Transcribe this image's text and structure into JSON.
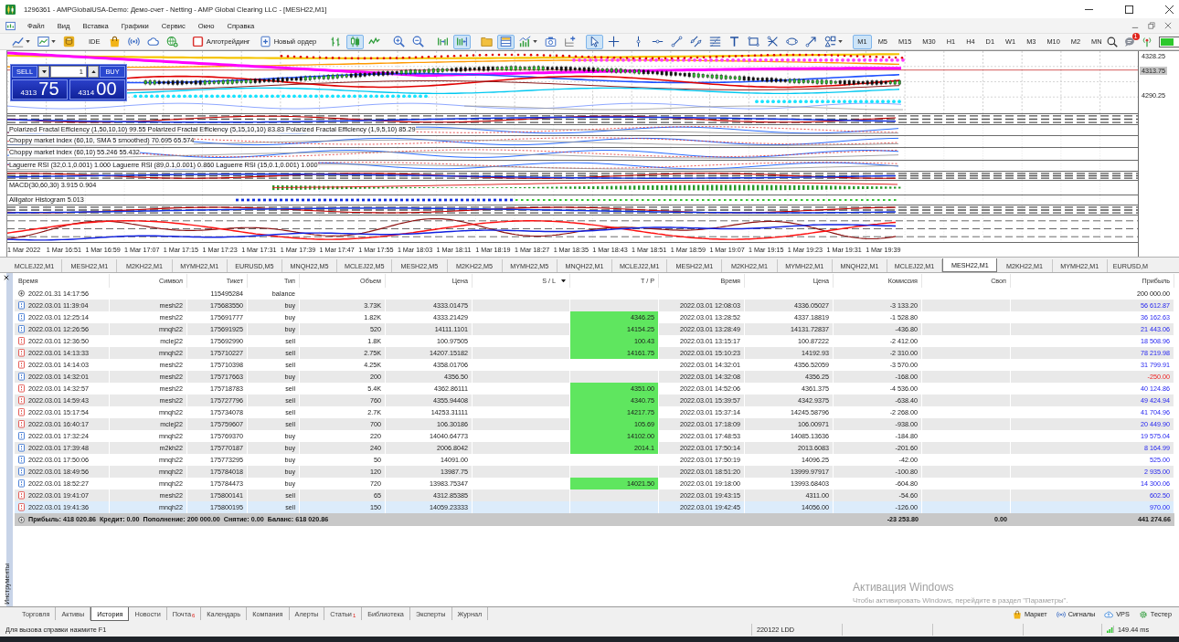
{
  "window": {
    "title": "1296361 - AMPGlobalUSA-Demo: Демо-счет - Netting - AMP Global Clearing LLC - [MESH22,M1]"
  },
  "menu": [
    "Файл",
    "Вид",
    "Вставка",
    "Графики",
    "Сервис",
    "Окно",
    "Справка"
  ],
  "toolbar": [
    [
      {
        "kind": "icon",
        "pressed": false
      },
      {
        "kind": "icon",
        "pressed": false
      },
      {
        "kind": "icon",
        "pressed": false
      }
    ],
    [
      {
        "kind": "label",
        "label": "IDE",
        "pressed": false
      },
      {
        "kind": "icon",
        "pressed": false
      },
      {
        "kind": "icon",
        "pressed": false
      },
      {
        "kind": "icon",
        "pressed": false
      },
      {
        "kind": "icon",
        "pressed": false
      }
    ],
    [
      {
        "kind": "icon_label",
        "label": "Алготрейдинг",
        "pressed": false
      },
      {
        "kind": "icon_label",
        "label": "Новый ордер",
        "pressed": false
      }
    ],
    [
      {
        "kind": "icon",
        "pressed": false
      },
      {
        "kind": "icon",
        "pressed": true
      },
      {
        "kind": "icon",
        "pressed": false
      }
    ],
    [
      {
        "kind": "icon",
        "pressed": false
      },
      {
        "kind": "icon",
        "pressed": false
      }
    ],
    [
      {
        "kind": "icon",
        "pressed": false
      },
      {
        "kind": "icon",
        "pressed": true
      }
    ],
    [
      {
        "kind": "icon",
        "pressed": false
      },
      {
        "kind": "icon",
        "pressed": true
      },
      {
        "kind": "icon",
        "pressed": false
      },
      {
        "kind": "icon",
        "pressed": false
      },
      {
        "kind": "icon",
        "pressed": false
      }
    ],
    [
      {
        "kind": "icon",
        "pressed": true
      },
      {
        "kind": "icon",
        "pressed": false
      }
    ],
    [
      {
        "kind": "icon",
        "pressed": false
      },
      {
        "kind": "icon",
        "pressed": false
      },
      {
        "kind": "icon",
        "pressed": false
      },
      {
        "kind": "icon",
        "pressed": false
      },
      {
        "kind": "icon",
        "pressed": false
      },
      {
        "kind": "icon",
        "pressed": false
      },
      {
        "kind": "icon",
        "pressed": false
      },
      {
        "kind": "icon",
        "pressed": false
      },
      {
        "kind": "icon",
        "pressed": false
      },
      {
        "kind": "icon",
        "pressed": false
      },
      {
        "kind": "icon",
        "pressed": false
      }
    ]
  ],
  "timeframes": [
    {
      "label": "M1",
      "selected": true
    },
    {
      "label": "M5",
      "selected": false
    },
    {
      "label": "M15",
      "selected": false
    },
    {
      "label": "M30",
      "selected": false
    },
    {
      "label": "H1",
      "selected": false
    },
    {
      "label": "H4",
      "selected": false
    },
    {
      "label": "D1",
      "selected": false
    },
    {
      "label": "W1",
      "selected": false
    },
    {
      "label": "M3",
      "selected": false
    },
    {
      "label": "M10",
      "selected": false
    },
    {
      "label": "M2",
      "selected": false
    },
    {
      "label": "MN",
      "selected": false
    }
  ],
  "notification_count": "1",
  "chart": {
    "trade_panel": {
      "sell": "SELL",
      "buy": "BUY",
      "volume": "1",
      "bid": {
        "main": "4313",
        "pips": "75"
      },
      "ask": {
        "main": "4314",
        "pips": "00"
      }
    },
    "price_axis": [
      {
        "kind": "tick",
        "label": "4328.25"
      },
      {
        "kind": "current",
        "label": "4313.75"
      },
      {
        "kind": "tick",
        "label": "4290.25"
      }
    ],
    "panes": [
      {
        "kind": "bands"
      },
      {
        "kind": "lines",
        "label": "Polarized Fractal Efficiency (1,50,10,10) 99.55 Polarized Fractal Efficiency (5,15,10,10) 83.83 Polarized Fractal Efficiency (1,9,5,10) 85.29"
      },
      {
        "kind": "lines",
        "label": "Choppy market index (60,10, SMA 5 smoothed) 70.695 65.574"
      },
      {
        "kind": "lines",
        "label": "Choppy market index (60,10) 55.246 55.432"
      },
      {
        "kind": "lines",
        "label": "Laguerre RSI (32,0.1,0.001) 1.000 Laguerre RSI (89,0.1,0.001) 0.860 Laguerre RSI (15,0.1,0.001) 1.000"
      },
      {
        "kind": "bands"
      },
      {
        "kind": "histogram",
        "label": "MACD(30,60,30) 3.915 0.904"
      },
      {
        "kind": "dots",
        "label": "Alligator Histogram 5.013"
      },
      {
        "kind": "bands"
      },
      {
        "kind": "oscillator"
      }
    ],
    "time_axis": [
      "1 Mar 2022",
      "1 Mar 16:51",
      "1 Mar 16:59",
      "1 Mar 17:07",
      "1 Mar 17:15",
      "1 Mar 17:23",
      "1 Mar 17:31",
      "1 Mar 17:39",
      "1 Mar 17:47",
      "1 Mar 17:55",
      "1 Mar 18:03",
      "1 Mar 18:11",
      "1 Mar 18:19",
      "1 Mar 18:27",
      "1 Mar 18:35",
      "1 Mar 18:43",
      "1 Mar 18:51",
      "1 Mar 18:59",
      "1 Mar 19:07",
      "1 Mar 19:15",
      "1 Mar 19:23",
      "1 Mar 19:31",
      "1 Mar 19:39"
    ]
  },
  "chart_tabs": [
    {
      "label": "MCLEJ22,M1",
      "selected": false
    },
    {
      "label": "MESH22,M1",
      "selected": false
    },
    {
      "label": "M2KH22,M1",
      "selected": false
    },
    {
      "label": "MYMH22,M1",
      "selected": false
    },
    {
      "label": "EURUSD,M5",
      "selected": false
    },
    {
      "label": "MNQH22,M5",
      "selected": false
    },
    {
      "label": "MCLEJ22,M5",
      "selected": false
    },
    {
      "label": "MESH22,M5",
      "selected": false
    },
    {
      "label": "M2KH22,M5",
      "selected": false
    },
    {
      "label": "MYMH22,M5",
      "selected": false
    },
    {
      "label": "MNQH22,M1",
      "selected": false
    },
    {
      "label": "MCLEJ22,M1",
      "selected": false
    },
    {
      "label": "MESH22,M1",
      "selected": false
    },
    {
      "label": "M2KH22,M1",
      "selected": false
    },
    {
      "label": "MYMH22,M1",
      "selected": false
    },
    {
      "label": "MNQH22,M1",
      "selected": false
    },
    {
      "label": "MCLEJ22,M1",
      "selected": false
    },
    {
      "label": "MESH22,M1",
      "selected": true
    },
    {
      "label": "M2KH22,M1",
      "selected": false
    },
    {
      "label": "MYMH22,M1",
      "selected": false
    },
    {
      "label": "EURUSD,M",
      "selected": false
    }
  ],
  "toolbox": {
    "side_label": "Инструменты",
    "table": {
      "columns": [
        {
          "label": "Время",
          "sorted": false
        },
        {
          "label": "Символ",
          "sorted": false
        },
        {
          "label": "Тикет",
          "sorted": false
        },
        {
          "label": "Тип",
          "sorted": false
        },
        {
          "label": "Объем",
          "sorted": false
        },
        {
          "label": "Цена",
          "sorted": false
        },
        {
          "label": "S / L",
          "sorted": true
        },
        {
          "label": "T / P",
          "sorted": false
        },
        {
          "label": "Время",
          "sorted": false
        },
        {
          "label": "Цена",
          "sorted": false
        },
        {
          "label": "Комиссия",
          "sorted": false
        },
        {
          "label": "Своп",
          "sorted": false
        },
        {
          "label": "Прибыль",
          "sorted": false
        }
      ],
      "rows": [
        {
          "kind": "balance",
          "selected": false,
          "time": "2022.01.31 14:17:56",
          "ticket": "115495284",
          "type": "balance",
          "profit": "200 000.00",
          "loss": false
        },
        {
          "kind": "buy",
          "selected": false,
          "time": "2022.03.01 11:39:04",
          "symbol": "mesh22",
          "ticket": "175683550",
          "type": "buy",
          "volume": "3.73K",
          "price": "4333.01475",
          "close_time": "2022.03.01 12:08:03",
          "close_price": "4336.05027",
          "commission": "-3 133.20",
          "profit": "56 612.87",
          "loss": false
        },
        {
          "kind": "buy",
          "selected": false,
          "time": "2022.03.01 12:25:14",
          "symbol": "mesh22",
          "ticket": "175691777",
          "type": "buy",
          "volume": "1.82K",
          "price": "4333.21429",
          "tp": "4346.25",
          "close_time": "2022.03.01 13:28:52",
          "close_price": "4337.18819",
          "commission": "-1 528.80",
          "profit": "36 162.63",
          "loss": false
        },
        {
          "kind": "buy",
          "selected": false,
          "time": "2022.03.01 12:26:56",
          "symbol": "mnqh22",
          "ticket": "175691925",
          "type": "buy",
          "volume": "520",
          "price": "14111.1101",
          "tp": "14154.25",
          "close_time": "2022.03.01 13:28:49",
          "close_price": "14131.72837",
          "commission": "-436.80",
          "profit": "21 443.06",
          "loss": false
        },
        {
          "kind": "sell",
          "selected": false,
          "time": "2022.03.01 12:36:50",
          "symbol": "mclej22",
          "ticket": "175692990",
          "type": "sell",
          "volume": "1.8K",
          "price": "100.97505",
          "tp": "100.43",
          "close_time": "2022.03.01 13:15:17",
          "close_price": "100.87222",
          "commission": "-2 412.00",
          "profit": "18 508.96",
          "loss": false
        },
        {
          "kind": "sell",
          "selected": false,
          "time": "2022.03.01 14:13:33",
          "symbol": "mnqh22",
          "ticket": "175710227",
          "type": "sell",
          "volume": "2.75K",
          "price": "14207.15182",
          "tp": "14161.75",
          "close_time": "2022.03.01 15:10:23",
          "close_price": "14192.93",
          "commission": "-2 310.00",
          "profit": "78 219.98",
          "loss": false
        },
        {
          "kind": "sell",
          "selected": false,
          "time": "2022.03.01 14:14:03",
          "symbol": "mesh22",
          "ticket": "175710398",
          "type": "sell",
          "volume": "4.25K",
          "price": "4358.01706",
          "close_time": "2022.03.01 14:32:01",
          "close_price": "4356.52059",
          "commission": "-3 570.00",
          "profit": "31 799.91",
          "loss": false
        },
        {
          "kind": "buy",
          "selected": false,
          "time": "2022.03.01 14:32:01",
          "symbol": "mesh22",
          "ticket": "175717663",
          "type": "buy",
          "volume": "200",
          "price": "4356.50",
          "close_time": "2022.03.01 14:32:08",
          "close_price": "4356.25",
          "commission": "-168.00",
          "profit": "-250.00",
          "loss": true
        },
        {
          "kind": "sell",
          "selected": false,
          "time": "2022.03.01 14:32:57",
          "symbol": "mesh22",
          "ticket": "175718783",
          "type": "sell",
          "volume": "5.4K",
          "price": "4362.86111",
          "tp": "4351.00",
          "close_time": "2022.03.01 14:52:06",
          "close_price": "4361.375",
          "commission": "-4 536.00",
          "profit": "40 124.86",
          "loss": false
        },
        {
          "kind": "sell",
          "selected": false,
          "time": "2022.03.01 14:59:43",
          "symbol": "mesh22",
          "ticket": "175727796",
          "type": "sell",
          "volume": "760",
          "price": "4355.94408",
          "tp": "4340.75",
          "close_time": "2022.03.01 15:39:57",
          "close_price": "4342.9375",
          "commission": "-638.40",
          "profit": "49 424.94",
          "loss": false
        },
        {
          "kind": "sell",
          "selected": false,
          "time": "2022.03.01 15:17:54",
          "symbol": "mnqh22",
          "ticket": "175734078",
          "type": "sell",
          "volume": "2.7K",
          "price": "14253.31111",
          "tp": "14217.75",
          "close_time": "2022.03.01 15:37:14",
          "close_price": "14245.58796",
          "commission": "-2 268.00",
          "profit": "41 704.96",
          "loss": false
        },
        {
          "kind": "sell",
          "selected": false,
          "time": "2022.03.01 16:40:17",
          "symbol": "mclej22",
          "ticket": "175759607",
          "type": "sell",
          "volume": "700",
          "price": "106.30186",
          "tp": "105.69",
          "close_time": "2022.03.01 17:18:09",
          "close_price": "106.00971",
          "commission": "-938.00",
          "profit": "20 449.90",
          "loss": false
        },
        {
          "kind": "buy",
          "selected": false,
          "time": "2022.03.01 17:32:24",
          "symbol": "mnqh22",
          "ticket": "175769370",
          "type": "buy",
          "volume": "220",
          "price": "14040.64773",
          "tp": "14102.00",
          "close_time": "2022.03.01 17:48:53",
          "close_price": "14085.13636",
          "commission": "-184.80",
          "profit": "19 575.04",
          "loss": false
        },
        {
          "kind": "buy",
          "selected": false,
          "time": "2022.03.01 17:39:48",
          "symbol": "m2kh22",
          "ticket": "175770187",
          "type": "buy",
          "volume": "240",
          "price": "2006.8042",
          "tp": "2014.1",
          "close_time": "2022.03.01 17:50:14",
          "close_price": "2013.6083",
          "commission": "-201.60",
          "profit": "8 164.99",
          "loss": false
        },
        {
          "kind": "buy",
          "selected": false,
          "time": "2022.03.01 17:50:06",
          "symbol": "mnqh22",
          "ticket": "175773295",
          "type": "buy",
          "volume": "50",
          "price": "14091.00",
          "close_time": "2022.03.01 17:50:19",
          "close_price": "14096.25",
          "commission": "-42.00",
          "profit": "525.00",
          "loss": false
        },
        {
          "kind": "buy",
          "selected": false,
          "time": "2022.03.01 18:49:56",
          "symbol": "mnqh22",
          "ticket": "175784018",
          "type": "buy",
          "volume": "120",
          "price": "13987.75",
          "close_time": "2022.03.01 18:51:20",
          "close_price": "13999.97917",
          "commission": "-100.80",
          "profit": "2 935.00",
          "loss": false
        },
        {
          "kind": "buy",
          "selected": false,
          "time": "2022.03.01 18:52:27",
          "symbol": "mnqh22",
          "ticket": "175784473",
          "type": "buy",
          "volume": "720",
          "price": "13983.75347",
          "tp": "14021.50",
          "close_time": "2022.03.01 19:18:00",
          "close_price": "13993.68403",
          "commission": "-604.80",
          "profit": "14 300.06",
          "loss": false
        },
        {
          "kind": "sell",
          "selected": false,
          "time": "2022.03.01 19:41:07",
          "symbol": "mesh22",
          "ticket": "175800141",
          "type": "sell",
          "volume": "65",
          "price": "4312.85385",
          "close_time": "2022.03.01 19:43:15",
          "close_price": "4311.00",
          "commission": "-54.60",
          "profit": "602.50",
          "loss": false
        },
        {
          "kind": "sell",
          "selected": true,
          "time": "2022.03.01 19:41:36",
          "symbol": "mnqh22",
          "ticket": "175800195",
          "type": "sell",
          "volume": "150",
          "price": "14059.23333",
          "close_time": "2022.03.01 19:42:45",
          "close_price": "14056.00",
          "commission": "-126.00",
          "profit": "970.00",
          "loss": false
        }
      ],
      "summary": {
        "items": [
          "Прибыль: 418 020.86",
          "Кредит: 0.00",
          "Пополнение: 200 000.00",
          "Снятие: 0.00",
          "Баланс: 618 020.86"
        ],
        "commission": "-23 253.80",
        "swap": "0.00",
        "profit": "441 274.66"
      }
    },
    "tabs": [
      {
        "label": "Торговля",
        "selected": false
      },
      {
        "label": "Активы",
        "selected": false
      },
      {
        "label": "История",
        "selected": true
      },
      {
        "label": "Новости",
        "selected": false
      },
      {
        "label": "Почта",
        "badge": "6",
        "selected": false
      },
      {
        "label": "Календарь",
        "selected": false
      },
      {
        "label": "Компания",
        "selected": false
      },
      {
        "label": "Алерты",
        "selected": false
      },
      {
        "label": "Статьи",
        "badge": "1",
        "selected": false
      },
      {
        "label": "Библиотека",
        "selected": false
      },
      {
        "label": "Эксперты",
        "selected": false
      },
      {
        "label": "Журнал",
        "selected": false
      }
    ],
    "links": [
      "Маркет",
      "Сигналы",
      "VPS",
      "Тестер"
    ]
  },
  "activation_notice": {
    "title": "Активация Windows",
    "text": "Чтобы активировать Windows, перейдите в раздел \"Параметры\"."
  },
  "status_bar": {
    "help": "Для вызова справки нажмите F1",
    "profile": "220122 LDD",
    "ping": "149.44 ms"
  }
}
